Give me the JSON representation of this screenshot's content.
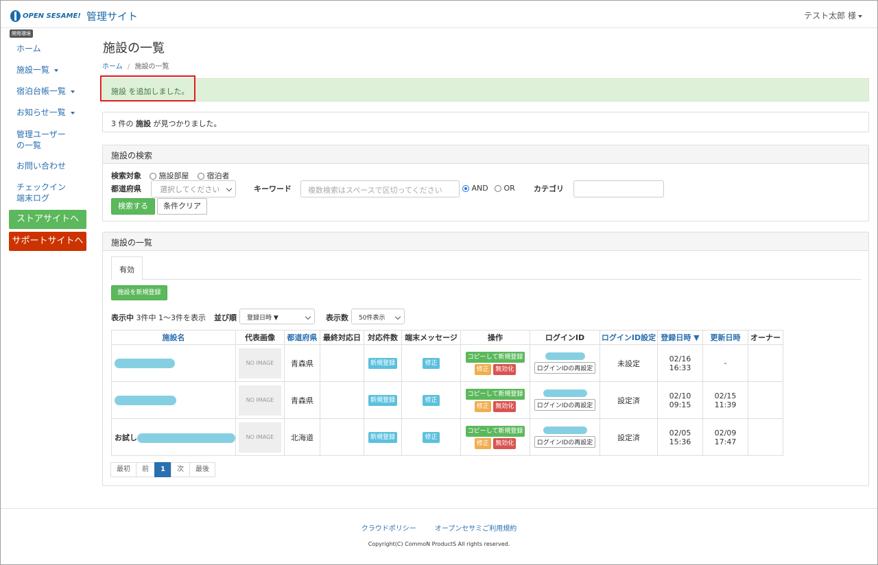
{
  "header": {
    "logo_text": "OPEN SESAME!",
    "site_title": "管理サイト",
    "user": "テスト太郎 様"
  },
  "env_badge": "開発環境",
  "sidebar": {
    "items": [
      {
        "label": "ホーム"
      },
      {
        "label": "施設一覧"
      },
      {
        "label": "宿泊台帳一覧"
      },
      {
        "label": "お知らせ一覧"
      },
      {
        "label": "管理ユーザーの一覧"
      },
      {
        "label": "お問い合わせ"
      },
      {
        "label": "チェックイン端末ログ"
      }
    ],
    "store_button": "ストアサイトへ",
    "support_button": "サポートサイトへ"
  },
  "page": {
    "title": "施設の一覧",
    "breadcrumb": [
      "ホーム",
      "/",
      "施設の一覧"
    ],
    "alert": "施設 を追加しました。",
    "result_prefix": "3 件の ",
    "result_bold": "施設",
    "result_suffix": " が見つかりました。"
  },
  "search": {
    "heading": "施設の検索",
    "target_label": "検索対象",
    "target_options": [
      "施設部屋",
      "宿泊者"
    ],
    "pref_label": "都道府県",
    "pref_placeholder": "選択してください",
    "keyword_label": "キーワード",
    "keyword_placeholder": "複数検索はスペースで区切ってください",
    "and_label": "AND",
    "or_label": "OR",
    "category_label": "カテゴリ",
    "search_button": "検索する",
    "clear_button": "条件クリア"
  },
  "list": {
    "heading": "施設の一覧",
    "tab": "有効",
    "new_button": "施設を新規登録",
    "display_prefix": "表示中",
    "display_info": "3件中 1〜3件を表示",
    "sort_label": "並び順",
    "sort_value": "登録日時 ▼",
    "count_label": "表示数",
    "count_value": "50件表示",
    "columns": [
      "施設名",
      "代表画像",
      "都道府県",
      "最終対応日",
      "対応件数",
      "端末メッセージ",
      "操作",
      "ログインID",
      "ログインID設定",
      "登録日時 ▼",
      "更新日時",
      "オーナー"
    ],
    "rows": [
      {
        "name_prefix": "",
        "no_image": "NO IMAGE",
        "pref": "青森県",
        "last_date": "",
        "count_btn": "新規登録",
        "msg_btn": "修正",
        "copy_btn": "コピーして新規登録",
        "edit_btn": "修正",
        "disable_btn": "無効化",
        "login_btn": "ログインIDの再設定",
        "login_setting": "未設定",
        "registered": "02/16 16:33",
        "updated": "-",
        "owner": ""
      },
      {
        "name_prefix": "",
        "no_image": "NO IMAGE",
        "pref": "青森県",
        "last_date": "",
        "count_btn": "新規登録",
        "msg_btn": "修正",
        "copy_btn": "コピーして新規登録",
        "edit_btn": "修正",
        "disable_btn": "無効化",
        "login_btn": "ログインIDの再設定",
        "login_setting": "設定済",
        "registered": "02/10 09:15",
        "updated": "02/15 11:39",
        "owner": ""
      },
      {
        "name_prefix": "お試し",
        "no_image": "NO IMAGE",
        "pref": "北海道",
        "last_date": "",
        "count_btn": "新規登録",
        "msg_btn": "修正",
        "copy_btn": "コピーして新規登録",
        "edit_btn": "修正",
        "disable_btn": "無効化",
        "login_btn": "ログインIDの再設定",
        "login_setting": "設定済",
        "registered": "02/05 15:36",
        "updated": "02/09 17:47",
        "owner": ""
      }
    ],
    "pager": [
      "最初",
      "前",
      "1",
      "次",
      "最後"
    ]
  },
  "footer": {
    "links": [
      "クラウドポリシー",
      "オープンセサミご利用規約"
    ],
    "copyright": "Copyright(C) CommoN ProductS All rights reserved."
  },
  "colors": {
    "brand": "#1b6aa8",
    "link": "#2a6fb0",
    "success": "#5cb85c",
    "danger": "#cc3300",
    "alert_bg": "#dff0d8",
    "highlight": "#e01a1a"
  }
}
